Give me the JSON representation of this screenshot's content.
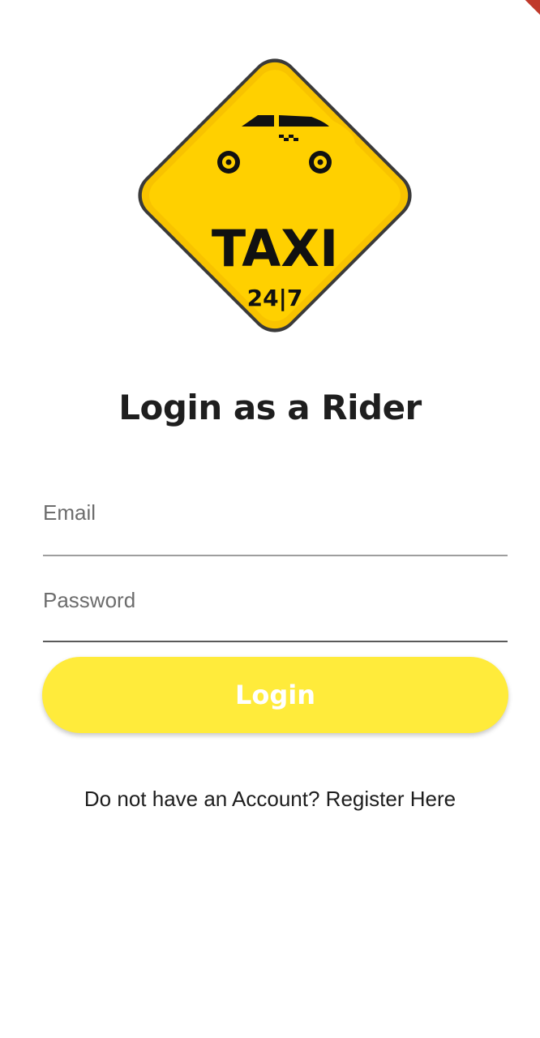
{
  "logo": {
    "brand_text": "TAXI",
    "sub_text": "24|7",
    "colors": {
      "yellow": "#ffc107",
      "black": "#111111"
    }
  },
  "title": "Login as a Rider",
  "form": {
    "email": {
      "placeholder": "Email",
      "value": ""
    },
    "password": {
      "placeholder": "Password",
      "value": ""
    },
    "login_label": "Login"
  },
  "register_link": "Do not have an Account? Register Here",
  "colors": {
    "button": "#ffeb3b",
    "button_text": "#ffffff",
    "text": "#1e1e1e",
    "underline": "#9e9e9e"
  }
}
